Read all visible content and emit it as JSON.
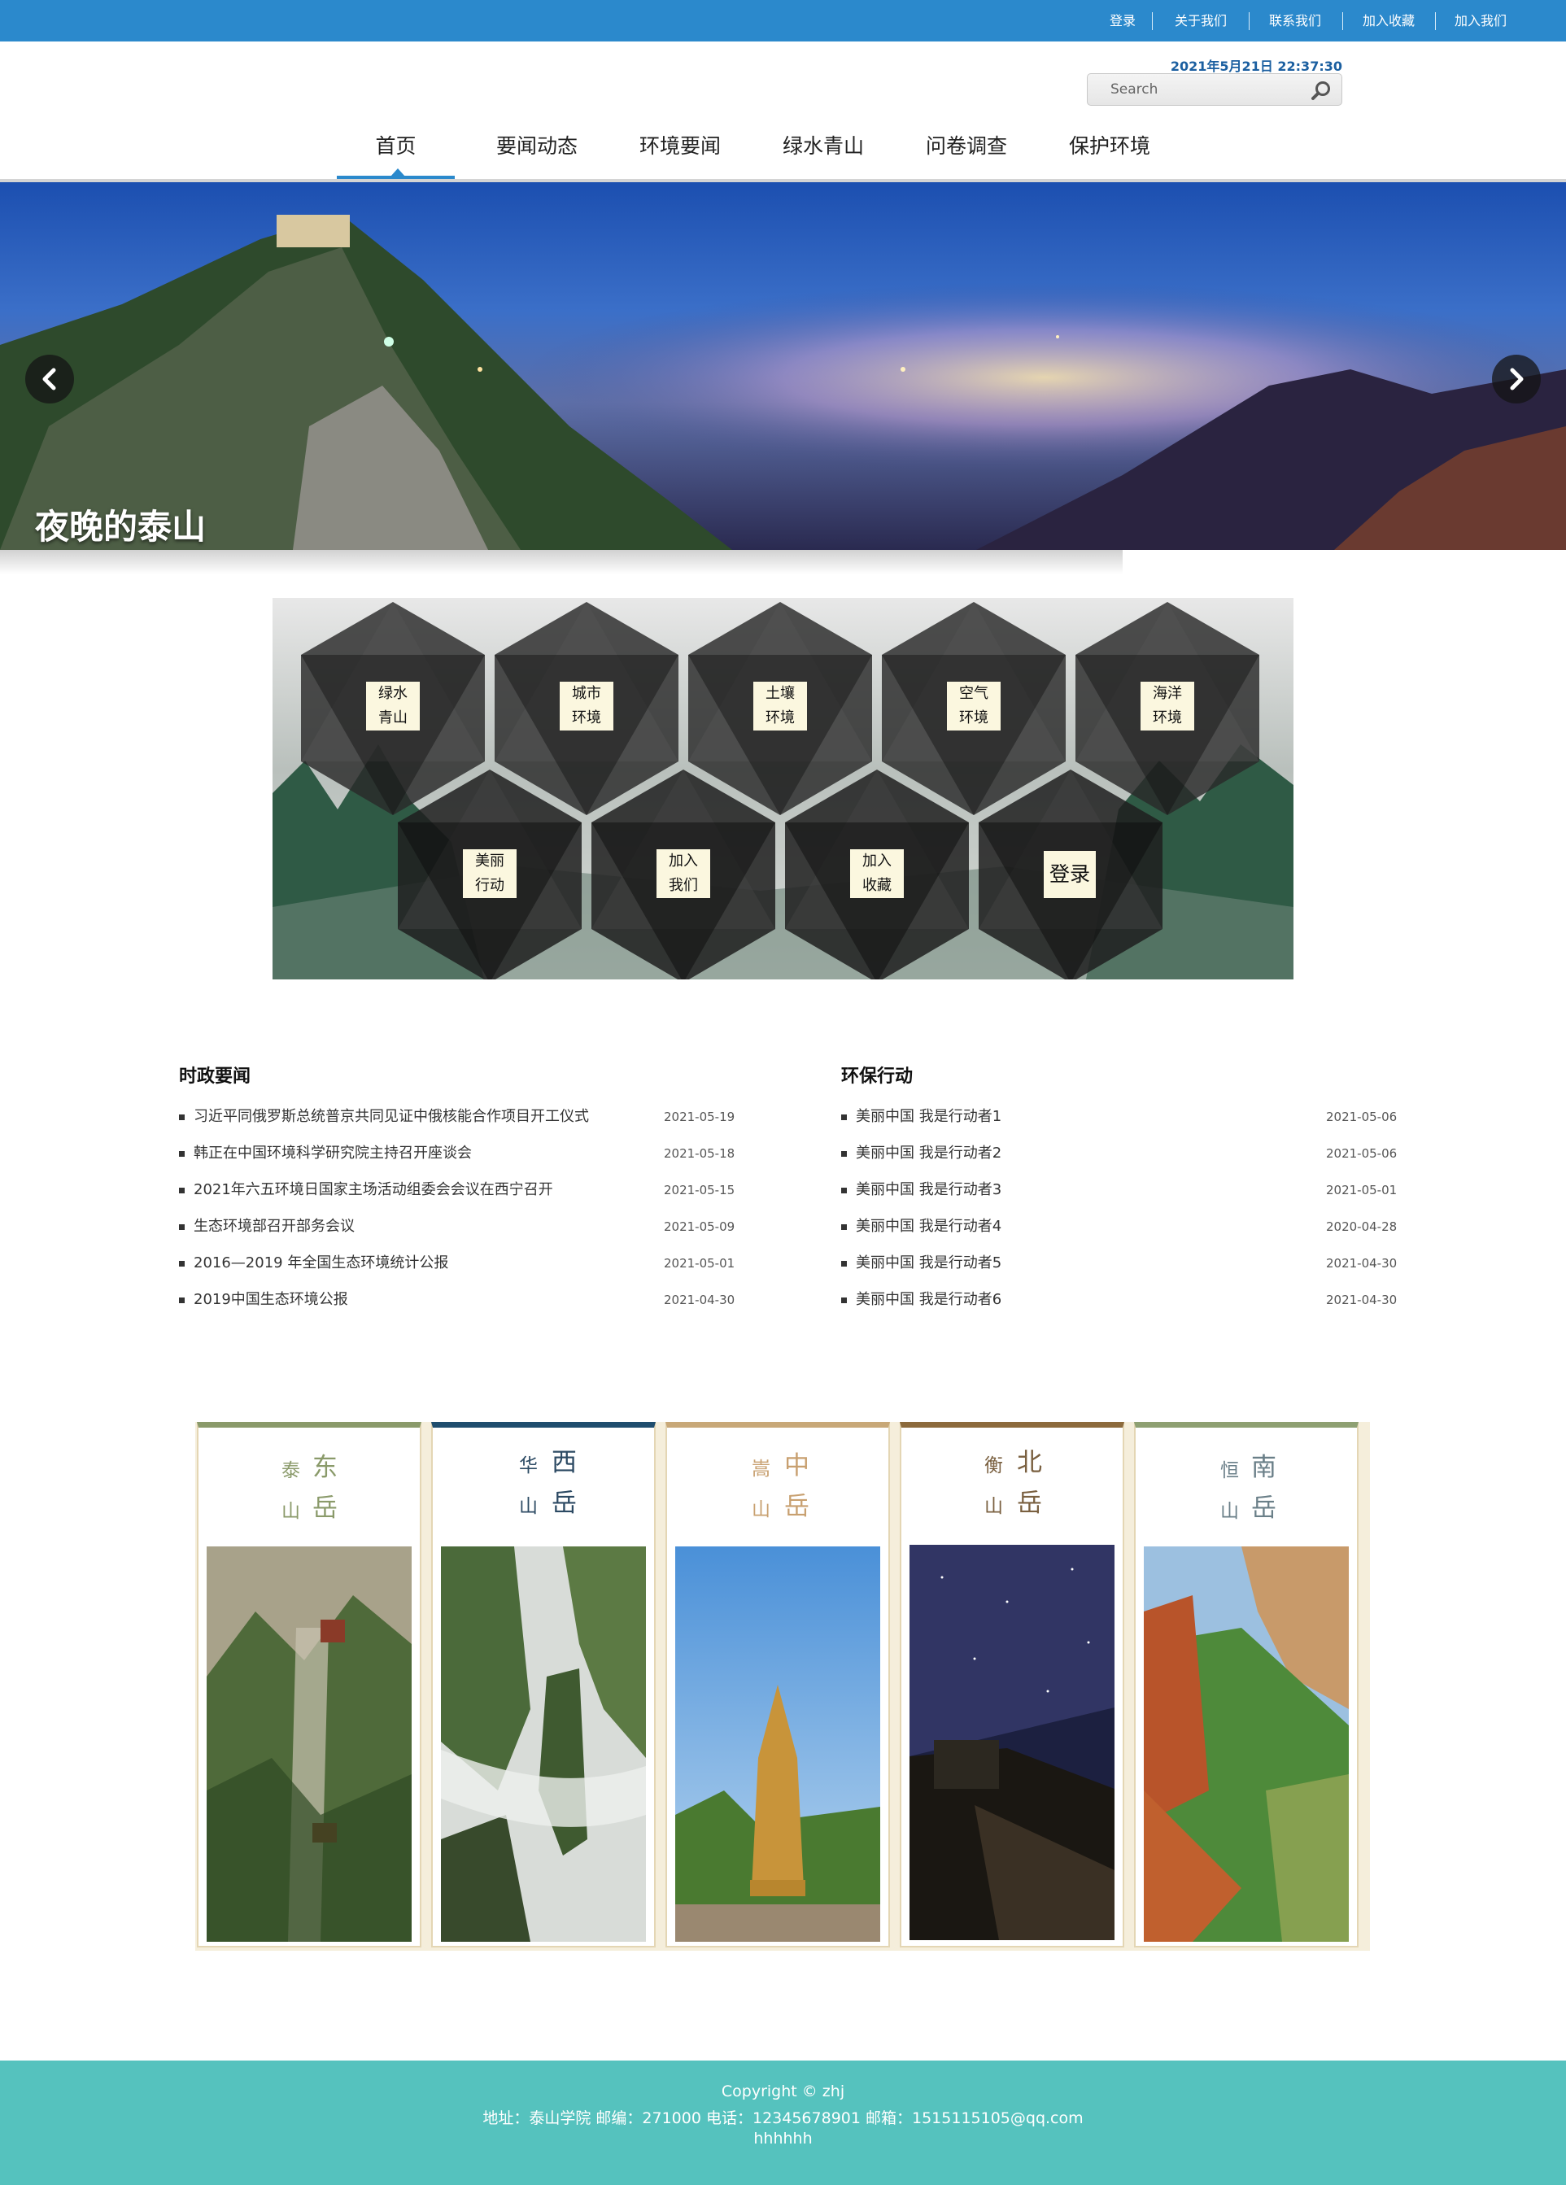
{
  "topbar": {
    "links": [
      "登录",
      "关于我们",
      "联系我们",
      "加入收藏",
      "加入我们"
    ],
    "color": "#2b89cc"
  },
  "header": {
    "datetime": "2021年5月21日 22:37:30",
    "search_placeholder": "Search",
    "search_icon": "search-icon"
  },
  "nav": {
    "items": [
      "首页",
      "要闻动态",
      "环境要闻",
      "绿水青山",
      "问卷调查",
      "保护环境"
    ],
    "active": "首页"
  },
  "banner": {
    "caption": "夜晚的泰山",
    "prev_icon": "chevron-left-icon",
    "next_icon": "chevron-right-icon"
  },
  "hex_menu": {
    "row1": [
      {
        "line1": "绿水",
        "line2": "青山"
      },
      {
        "line1": "城市",
        "line2": "环境"
      },
      {
        "line1": "土壤",
        "line2": "环境"
      },
      {
        "line1": "空气",
        "line2": "环境"
      },
      {
        "line1": "海洋",
        "line2": "环境"
      }
    ],
    "row2": [
      {
        "line1": "美丽",
        "line2": "行动"
      },
      {
        "line1": "加入",
        "line2": "我们"
      },
      {
        "line1": "加入",
        "line2": "收藏"
      },
      {
        "line1": "登录",
        "line2": ""
      }
    ]
  },
  "news": {
    "politics": {
      "title": "时政要闻",
      "items": [
        {
          "text": "习近平同俄罗斯总统普京共同见证中俄核能合作项目开工仪式",
          "date": "2021-05-19"
        },
        {
          "text": "韩正在中国环境科学研究院主持召开座谈会",
          "date": "2021-05-18"
        },
        {
          "text": "2021年六五环境日国家主场活动组委会会议在西宁召开",
          "date": "2021-05-15"
        },
        {
          "text": "生态环境部召开部务会议",
          "date": "2021-05-09"
        },
        {
          "text": "2016—2019 年全国生态环境统计公报",
          "date": "2021-05-01"
        },
        {
          "text": "2019中国生态环境公报",
          "date": "2021-04-30"
        }
      ]
    },
    "action": {
      "title": "环保行动",
      "items": [
        {
          "text": "美丽中国 我是行动者1",
          "date": "2021-05-06"
        },
        {
          "text": "美丽中国 我是行动者2",
          "date": "2021-05-06"
        },
        {
          "text": "美丽中国 我是行动者3",
          "date": "2021-05-01"
        },
        {
          "text": "美丽中国 我是行动者4",
          "date": "2020-04-28"
        },
        {
          "text": "美丽中国 我是行动者5",
          "date": "2021-04-30"
        },
        {
          "text": "美丽中国 我是行动者6",
          "date": "2021-04-30"
        }
      ]
    }
  },
  "mountains": [
    {
      "big1": "东",
      "big2": "岳",
      "small1": "泰",
      "small2": "山",
      "accent": "#8a9a6a",
      "text_color": "#8a9a6a"
    },
    {
      "big1": "西",
      "big2": "岳",
      "small1": "华",
      "small2": "山",
      "accent": "#1f4d6e",
      "text_color": "#2c4a63"
    },
    {
      "big1": "中",
      "big2": "岳",
      "small1": "嵩",
      "small2": "山",
      "accent": "#c8a878",
      "text_color": "#c8a070"
    },
    {
      "big1": "北",
      "big2": "岳",
      "small1": "衡",
      "small2": "山",
      "accent": "#8c6a3c",
      "text_color": "#7a6040"
    },
    {
      "big1": "南",
      "big2": "岳",
      "small1": "恒",
      "small2": "山",
      "accent": "#8ea072",
      "text_color": "#6a7f88"
    }
  ],
  "footer": {
    "copyright": "Copyright © zhj",
    "address": "地址：泰山学院 邮编：271000 电话：12345678901 邮箱：1515115105@qq.com",
    "extra": "hhhhhh",
    "color": "#55c2be"
  }
}
